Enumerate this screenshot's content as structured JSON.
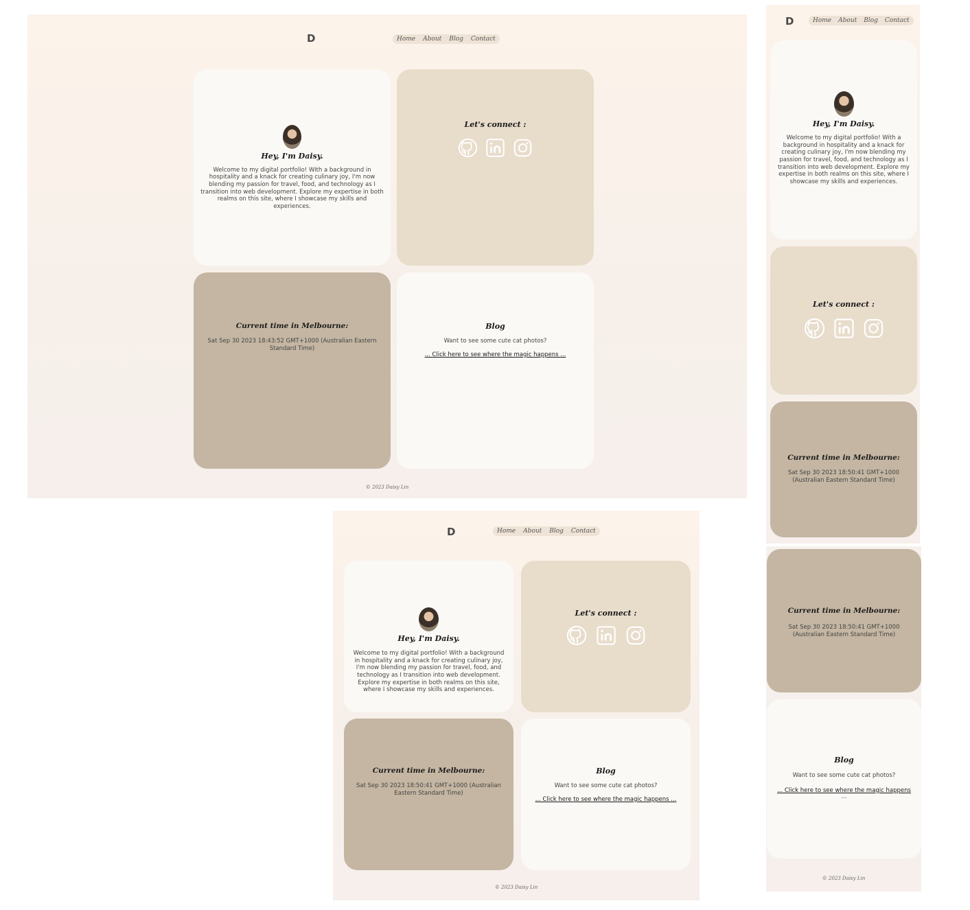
{
  "site": {
    "logo": "D",
    "nav": [
      "Home",
      "About",
      "Blog",
      "Contact"
    ],
    "footer": "© 2023 Daisy Lin"
  },
  "intro": {
    "heading": "Hey,  I'm Daisy.",
    "body": "Welcome to my digital portfolio! With a background in hospitality and a knack for creating culinary joy, I'm now blending my passion for travel, food, and technology as I transition into web development. Explore my expertise in both realms on this site, where I showcase my skills and experiences."
  },
  "connect": {
    "heading": "Let's connect :",
    "icons": [
      "github-icon",
      "linkedin-icon",
      "instagram-icon"
    ]
  },
  "time": {
    "heading": "Current time in Melbourne:",
    "desktop_value": "Sat Sep 30 2023 18:43:52 GMT+1000 (Australian Eastern Standard Time)",
    "value": "Sat Sep 30 2023 18:50:41 GMT+1000 (Australian Eastern Standard Time)"
  },
  "blog": {
    "heading": "Blog",
    "body": "Want to see some cute cat photos?",
    "link": "... Click here to see where the magic happens ...",
    "mobile_link_main": "... Click here to see where the magic happens",
    "mobile_link_tail": "..."
  },
  "colors": {
    "light_card": "#fbf9f6",
    "sand_card": "#e8dccb",
    "taupe_card": "#c4b6a2",
    "menu_pill": "#eee3d6"
  }
}
